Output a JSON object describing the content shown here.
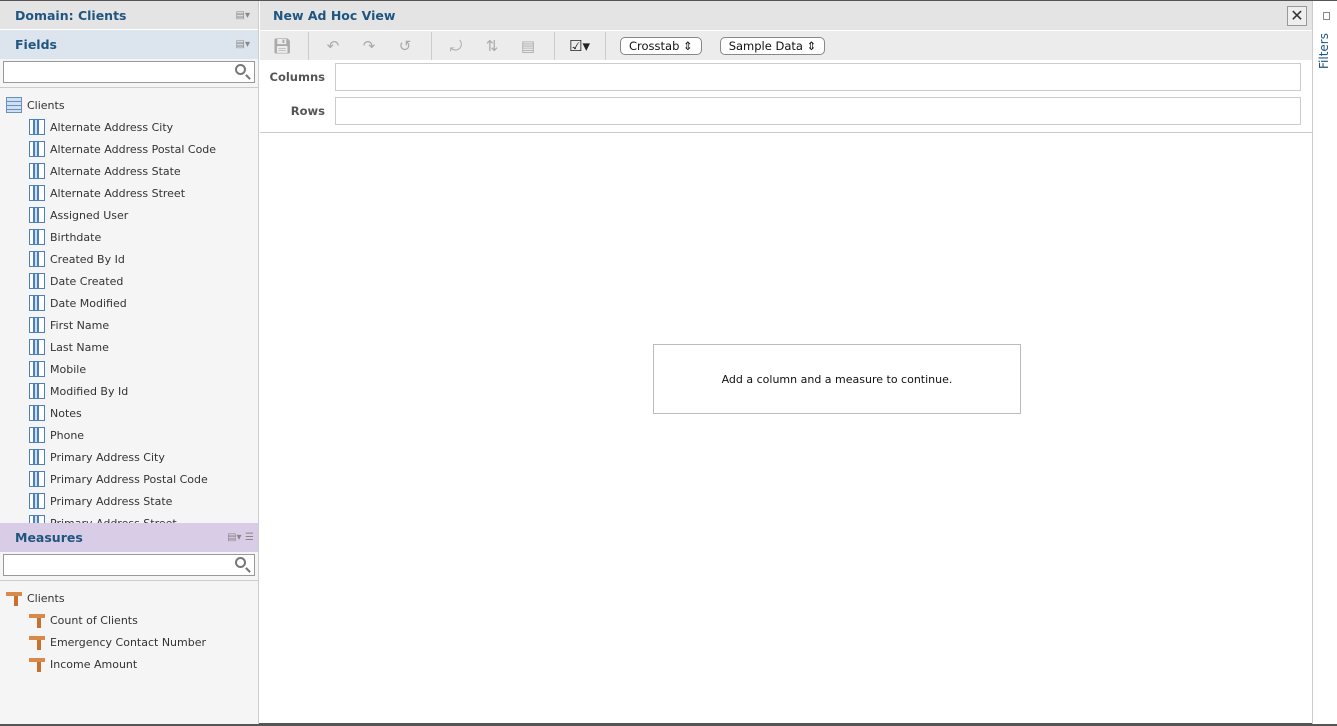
{
  "left": {
    "domain_title": "Domain: Clients",
    "fields": {
      "title": "Fields",
      "search_placeholder": "",
      "root": "Clients",
      "items": [
        "Alternate Address City",
        "Alternate Address Postal Code",
        "Alternate Address State",
        "Alternate Address Street",
        "Assigned User",
        "Birthdate",
        "Created By Id",
        "Date Created",
        "Date Modified",
        "First Name",
        "Last Name",
        "Mobile",
        "Modified By Id",
        "Notes",
        "Phone",
        "Primary Address City",
        "Primary Address Postal Code",
        "Primary Address State",
        "Primary Address Street"
      ]
    },
    "measures": {
      "title": "Measures",
      "search_placeholder": "",
      "root": "Clients",
      "items": [
        "Count of Clients",
        "Emergency Contact Number",
        "Income Amount"
      ]
    }
  },
  "main": {
    "title": "New Ad Hoc View",
    "toolbar": {
      "view_type": "Crosstab",
      "data_mode": "Sample Data"
    },
    "columns_label": "Columns",
    "rows_label": "Rows",
    "message": "Add a column and a measure to continue."
  },
  "right": {
    "filters_label": "Filters"
  },
  "colors": {
    "accent": "#1f5580",
    "fields_header": "#dce5ee",
    "measures_header": "#d9cce6"
  }
}
